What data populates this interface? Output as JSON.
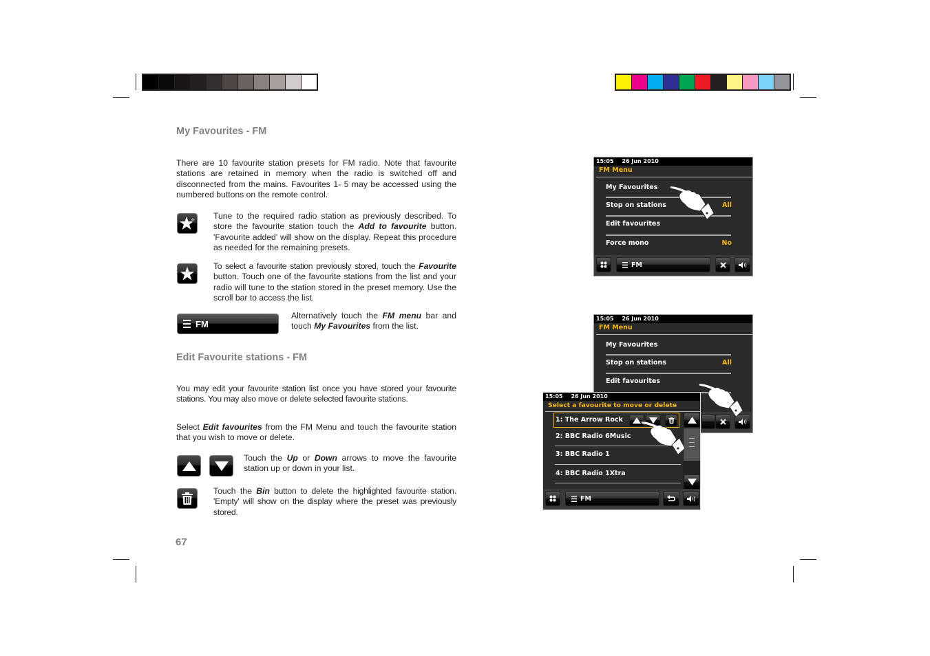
{
  "print_marks": {
    "grayscale_bar": [
      "#000000",
      "#0c0a09",
      "#1a1615",
      "#231f1e",
      "#353030",
      "#4f4745",
      "#6b6260",
      "#8a807d",
      "#a89f9c",
      "#d2cbcb",
      "#ffffff"
    ],
    "color_bar": [
      "#fff200",
      "#ec008c",
      "#00aeef",
      "#2e3192",
      "#00a651",
      "#ed1c24",
      "#231f20",
      "#fff685",
      "#f49ac1",
      "#7dd3f7",
      "#939598"
    ]
  },
  "section1": {
    "heading": "My Favourites - FM",
    "intro": "There are 10 favourite station presets for FM radio. Note that favourite stations are retained in memory when the radio is switched off and disconnected from the mains. Favourites 1- 5 may be accessed using the numbered buttons on the remote control.",
    "add_text_1": "Tune to the required radio station as previously described. To store the favourite station touch the ",
    "add_text_bold": "Add to favourite",
    "add_text_2": " button. 'Favourite added' will show on the display. Repeat this procedure as needed for the remaining presets.",
    "select_text_1": "To select a favourite station previously stored, touch the ",
    "select_text_bold": "Favourite",
    "select_text_2": " button. Touch one of the favourite stations from the list and your radio will tune to the station stored in the preset memory. Use the scroll bar to access the list.",
    "fm_bar_label": "FM",
    "alt_text_1": "Alternatively touch the ",
    "alt_text_bold1": "FM menu",
    "alt_text_2": " bar and touch ",
    "alt_text_bold2": "My Favourites",
    "alt_text_3": " from the list."
  },
  "section2": {
    "heading": "Edit Favourite stations - FM",
    "intro": "You may edit your favourite station list once you have stored your favourite stations. You may also move or delete selected favourite stations.",
    "select_1": "Select ",
    "select_bold": "Edit favourites",
    "select_2": " from the FM Menu and touch the favourite station that you wish to move or delete.",
    "updown_1": "Touch the ",
    "updown_bold1": "Up",
    "updown_2": " or ",
    "updown_bold2": "Down",
    "updown_3": " arrows to move the favourite station up or down in your list.",
    "bin_1": "Touch the ",
    "bin_bold": "Bin",
    "bin_2": " button to delete the highlighted favourite station. 'Empty' will show on the display where the preset was previously stored."
  },
  "page_number": "67",
  "screen1": {
    "time": "15:05",
    "date": "26 Jun 2010",
    "title": "FM Menu",
    "items": [
      {
        "label": "My Favourites",
        "value": ""
      },
      {
        "label": "Stop on stations",
        "value": "All"
      },
      {
        "label": "Edit favourites",
        "value": ""
      },
      {
        "label": "Force mono",
        "value": "No"
      }
    ],
    "toolbar_label": "FM"
  },
  "screen2": {
    "time": "15:05",
    "date": "26 Jun 2010",
    "title": "FM Menu",
    "items": [
      {
        "label": "My Favourites",
        "value": ""
      },
      {
        "label": "Stop on stations",
        "value": "All"
      },
      {
        "label": "Edit favourites",
        "value": ""
      }
    ]
  },
  "screen3": {
    "time": "15:05",
    "date": "26 Jun 2010",
    "title": "Select a favourite to move or delete",
    "items": [
      "1: The Arrow Rock",
      "2: BBC Radio 6Music",
      "3: BBC Radio 1",
      "4: BBC Radio 1Xtra"
    ],
    "toolbar_label": "FM"
  },
  "colors": {
    "accent_yellow": "#f2b417",
    "heading_gray": "#808080"
  }
}
